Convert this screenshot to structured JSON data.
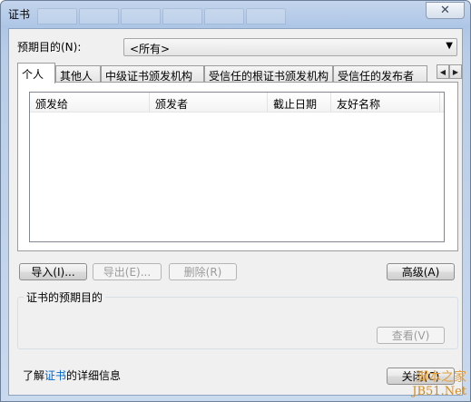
{
  "window": {
    "title": "证书",
    "close_glyph": "✕"
  },
  "purpose": {
    "label": "预期目的(N):",
    "selected": "<所有>"
  },
  "tabs": [
    {
      "label": "个人",
      "active": true
    },
    {
      "label": "其他人",
      "active": false
    },
    {
      "label": "中级证书颁发机构",
      "active": false
    },
    {
      "label": "受信任的根证书颁发机构",
      "active": false
    },
    {
      "label": "受信任的发布者",
      "active": false
    }
  ],
  "tab_scroll": {
    "left": "◀",
    "right": "▶"
  },
  "list": {
    "columns": [
      "颁发给",
      "颁发者",
      "截止日期",
      "友好名称"
    ],
    "rows": []
  },
  "buttons": {
    "import": "导入(I)...",
    "export": "导出(E)...",
    "remove": "删除(R)",
    "advanced": "高级(A)",
    "view": "查看(V)",
    "close": "关闭(C)"
  },
  "purposes_group": {
    "title": "证书的预期目的"
  },
  "learn_more": {
    "prefix": "了解",
    "link": "证书",
    "suffix": "的详细信息"
  },
  "watermark": {
    "line1": "脚本之家",
    "line2": "JB51.Net"
  }
}
